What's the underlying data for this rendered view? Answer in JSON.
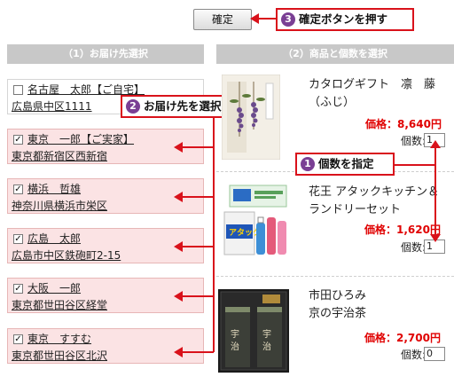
{
  "confirm_button": {
    "label": "確定"
  },
  "callouts": {
    "confirm": {
      "number": "3",
      "text": "確定ボタンを押す"
    },
    "select_dest": {
      "number": "2",
      "text": "お届け先を選択"
    },
    "qty": {
      "number": "1",
      "text": "個数を指定"
    }
  },
  "left_header": "（1）お届け先選択",
  "right_header": "（2）商品と個数を選択",
  "addresses": [
    {
      "name": "名古屋　太郎【ご自宅】",
      "location": "広島県中区1111",
      "checked": false
    },
    {
      "name": "東京　一郎【ご実家】",
      "location": "東京都新宿区西新宿",
      "checked": true
    },
    {
      "name": "横浜　哲雄",
      "location": "神奈川県横浜市栄区",
      "checked": true
    },
    {
      "name": "広島　太郎",
      "location": "広島市中区鉄砲町2-15",
      "checked": true
    },
    {
      "name": "大阪　一郎",
      "location": "東京都世田谷区経堂",
      "checked": true
    },
    {
      "name": "東京　すすむ",
      "location": "東京都世田谷区北沢",
      "checked": true
    }
  ],
  "products": [
    {
      "name1": "カタログギフト　凛　藤",
      "name2": "（ふじ）",
      "price": "価格：8,640円",
      "qty_label": "個数:",
      "qty": "1"
    },
    {
      "name1": "花王 アタックキッチン＆",
      "name2": "ランドリーセット",
      "price": "価格：1,620円",
      "qty_label": "個数:",
      "qty": "1"
    },
    {
      "name1": "市田ひろみ",
      "name2": "京の宇治茶",
      "price": "価格：2,700円",
      "qty_label": "個数:",
      "qty": "0"
    }
  ],
  "colors": {
    "accent": "#d9121b",
    "price": "#e00000",
    "row_bg": "#fbe3e4",
    "header_bg": "#c8c8c8",
    "callout_num": "#7a3f94"
  }
}
